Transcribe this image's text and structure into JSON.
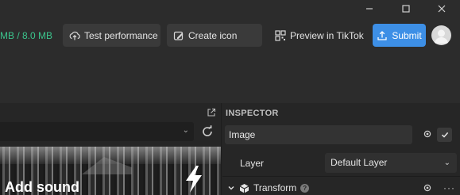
{
  "window": {
    "minimize_icon": "minimize-icon",
    "maximize_icon": "maximize-icon",
    "close_icon": "close-icon"
  },
  "toolbar": {
    "size_text": "MB / 8.0 MB",
    "size_color": "#3bc48c",
    "test_performance_label": "Test performance",
    "create_icon_label": "Create icon",
    "preview_label": "Preview in TikTok",
    "submit_label": "Submit",
    "submit_color": "#3d8fe6"
  },
  "scene": {
    "overlay_text": "Add sound"
  },
  "inspector": {
    "title": "INSPECTOR",
    "object_name": "Image",
    "layer_label": "Layer",
    "layer_value": "Default Layer",
    "component_name": "Transform",
    "help_glyph": "?",
    "more_glyph": "···"
  }
}
